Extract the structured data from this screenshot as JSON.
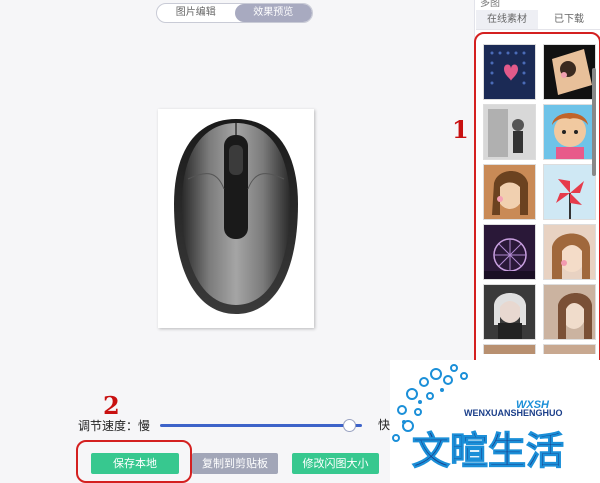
{
  "tabs": {
    "edit_label": "图片编辑",
    "preview_label": "效果预览"
  },
  "side_panel": {
    "title": "多图",
    "tab_online": "在线素材",
    "tab_downloaded": "已下载"
  },
  "speed": {
    "label": "调节速度：慢",
    "fast_label": "快",
    "value_fraction": 0.94
  },
  "buttons": {
    "save": "保存本地",
    "copy": "复制到剪贴板",
    "resize": "修改闪图大小"
  },
  "annotations": {
    "marker_1": "1",
    "marker_2": "2"
  },
  "logo": {
    "text_cn": "文暄生活",
    "text_pinyin": "WENXUANSHENGHUO",
    "text_abbr": "WXSH"
  },
  "colors": {
    "accent_green": "#37c88f",
    "annotation_red": "#d42020",
    "slider_blue": "#3d63c9"
  }
}
